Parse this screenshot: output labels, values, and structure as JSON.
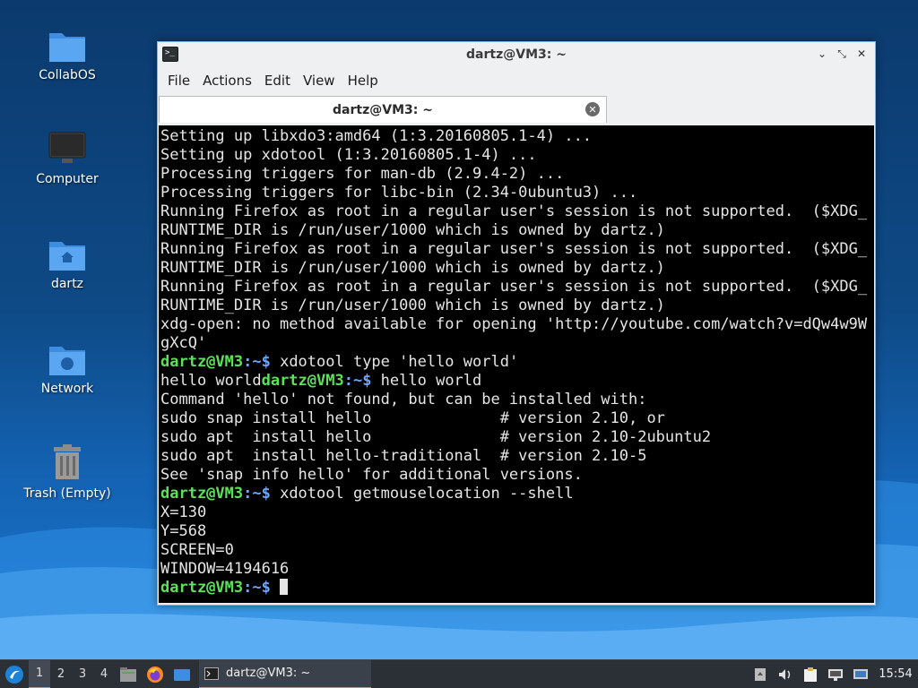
{
  "desktop": {
    "icons": [
      {
        "label": "CollabOS"
      },
      {
        "label": "Computer"
      },
      {
        "label": "dartz"
      },
      {
        "label": "Network"
      },
      {
        "label": "Trash (Empty)"
      }
    ]
  },
  "window": {
    "title": "dartz@VM3: ~",
    "menu": [
      "File",
      "Actions",
      "Edit",
      "View",
      "Help"
    ],
    "tab_label": "dartz@VM3: ~",
    "controls": {
      "minimize": "⌄",
      "restore": "⤡",
      "close": "✕"
    }
  },
  "terminal": {
    "prompt_user": "dartz@VM3",
    "prompt_path": ":~$",
    "lines": [
      {
        "text": "Setting up libxdo3:amd64 (1:3.20160805.1-4) ..."
      },
      {
        "text": "Setting up xdotool (1:3.20160805.1-4) ..."
      },
      {
        "text": "Processing triggers for man-db (2.9.4-2) ..."
      },
      {
        "text": "Processing triggers for libc-bin (2.34-0ubuntu3) ..."
      },
      {
        "text": "Running Firefox as root in a regular user's session is not supported.  ($XDG_"
      },
      {
        "text": "RUNTIME_DIR is /run/user/1000 which is owned by dartz.)"
      },
      {
        "text": "Running Firefox as root in a regular user's session is not supported.  ($XDG_"
      },
      {
        "text": "RUNTIME_DIR is /run/user/1000 which is owned by dartz.)"
      },
      {
        "text": "Running Firefox as root in a regular user's session is not supported.  ($XDG_"
      },
      {
        "text": "RUNTIME_DIR is /run/user/1000 which is owned by dartz.)"
      },
      {
        "text": "xdg-open: no method available for opening 'http://youtube.com/watch?v=dQw4w9W"
      },
      {
        "text": "gXcQ'"
      },
      {
        "prompt": true,
        "cmd": " xdotool type 'hello world'"
      },
      {
        "pre": "hello world",
        "prompt": true,
        "cmd": " hello world"
      },
      {
        "text": "Command 'hello' not found, but can be installed with:"
      },
      {
        "text": "sudo snap install hello              # version 2.10, or"
      },
      {
        "text": "sudo apt  install hello              # version 2.10-2ubuntu2"
      },
      {
        "text": "sudo apt  install hello-traditional  # version 2.10-5"
      },
      {
        "text": "See 'snap info hello' for additional versions."
      },
      {
        "prompt": true,
        "cmd": " xdotool getmouselocation --shell"
      },
      {
        "text": "X=130"
      },
      {
        "text": "Y=568"
      },
      {
        "text": "SCREEN=0"
      },
      {
        "text": "WINDOW=4194616"
      },
      {
        "prompt": true,
        "cmd": " ",
        "cursor": true
      }
    ]
  },
  "taskbar": {
    "workspaces": [
      "1",
      "2",
      "3",
      "4"
    ],
    "active_workspace": "1",
    "task_label": "dartz@VM3: ~",
    "clock": "15:54"
  }
}
